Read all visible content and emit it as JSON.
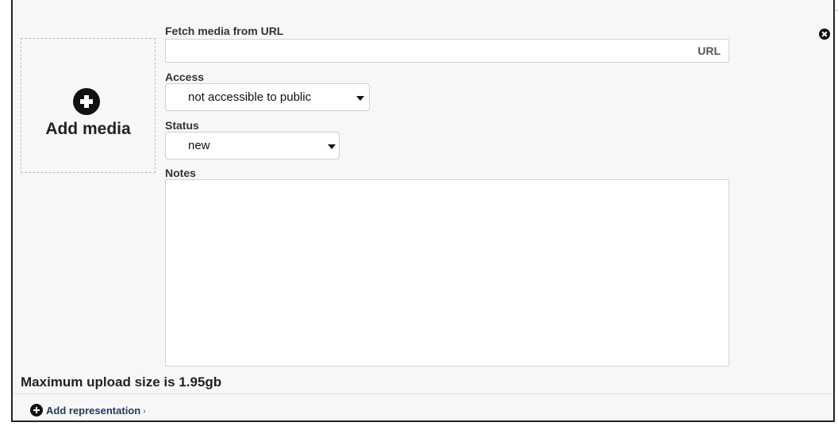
{
  "dropzone": {
    "label": "Add media"
  },
  "fetch_url": {
    "label": "Fetch media from URL",
    "value": "",
    "placeholder": "URL"
  },
  "access": {
    "label": "Access",
    "selected": "not accessible to public"
  },
  "status": {
    "label": "Status",
    "selected": "new"
  },
  "notes": {
    "label": "Notes",
    "value": ""
  },
  "upload": {
    "max_text": "Maximum upload size is 1.95gb"
  },
  "footer": {
    "add_representation": "Add representation",
    "arrow": "›"
  },
  "icons": {
    "add_media": "plus-circle-icon",
    "close": "close-circle-icon",
    "add_representation": "plus-circle-icon",
    "dropdown": "caret-down-icon"
  },
  "colors": {
    "link": "#1f3a5a",
    "panel_bg": "#f7f7f7",
    "border": "#222222"
  }
}
